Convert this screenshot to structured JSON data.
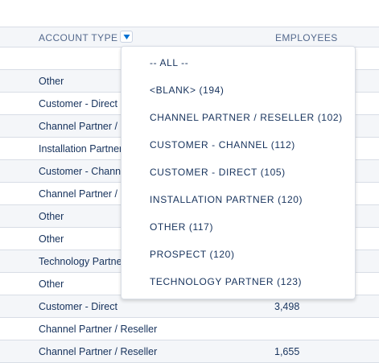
{
  "header": {
    "account_type": "ACCOUNT TYPE",
    "employees": "EMPLOYEES",
    "filter_icon": "chevron-down-icon"
  },
  "rows": [
    {
      "type": "",
      "employees": ""
    },
    {
      "type": "Other",
      "employees": ""
    },
    {
      "type": "Customer - Direct",
      "employees": ""
    },
    {
      "type": "Channel Partner / Reseller",
      "employees": ""
    },
    {
      "type": "Installation Partner",
      "employees": ""
    },
    {
      "type": "Customer - Channel",
      "employees": ""
    },
    {
      "type": "Channel Partner / Reseller",
      "employees": ""
    },
    {
      "type": "Other",
      "employees": ""
    },
    {
      "type": "Other",
      "employees": ""
    },
    {
      "type": "Technology Partner",
      "employees": ""
    },
    {
      "type": "Other",
      "employees": ""
    },
    {
      "type": "Customer - Direct",
      "employees": "3,498"
    },
    {
      "type": "Channel Partner / Reseller",
      "employees": ""
    },
    {
      "type": "Channel Partner / Reseller",
      "employees": "1,655"
    }
  ],
  "dropdown": {
    "items": [
      "-- ALL --",
      "<BLANK> (194)",
      "CHANNEL PARTNER / RESELLER (102)",
      "CUSTOMER - CHANNEL (112)",
      "CUSTOMER - DIRECT (105)",
      "INSTALLATION PARTNER (120)",
      "OTHER (117)",
      "PROSPECT (120)",
      "TECHNOLOGY PARTNER (123)"
    ]
  },
  "colors": {
    "header_bg": "#f4f6f9",
    "alt_row_bg": "#f4f6f9",
    "border": "#d8dde6",
    "text": "#16325c",
    "header_text": "#54698d",
    "accent": "#0070d2"
  }
}
